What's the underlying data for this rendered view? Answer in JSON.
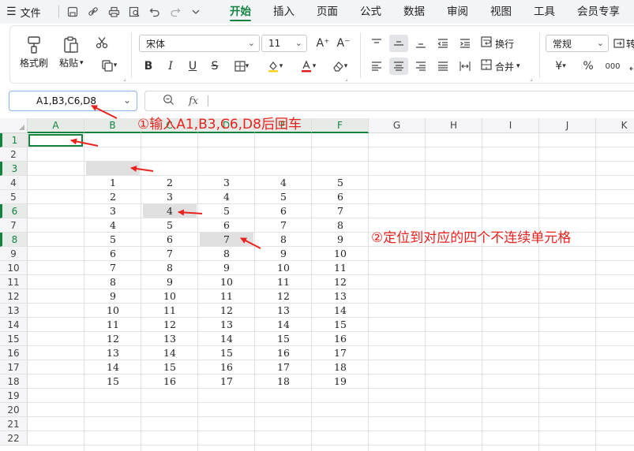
{
  "menubar": {
    "hamburger_icon": "☰",
    "file_label": "文件",
    "quick_icons": [
      "save-icon",
      "link-icon",
      "print-icon",
      "print-preview-icon",
      "undo-icon",
      "redo-icon",
      "more-chevron-icon"
    ],
    "tabs": [
      {
        "label": "开始",
        "active": true
      },
      {
        "label": "插入",
        "active": false
      },
      {
        "label": "页面",
        "active": false
      },
      {
        "label": "公式",
        "active": false
      },
      {
        "label": "数据",
        "active": false
      },
      {
        "label": "审阅",
        "active": false
      },
      {
        "label": "视图",
        "active": false
      },
      {
        "label": "工具",
        "active": false
      },
      {
        "label": "会员专享",
        "active": false
      }
    ]
  },
  "ribbon": {
    "format_painter_label": "格式刷",
    "paste_label": "粘贴",
    "font_name": "宋体",
    "font_size": "11",
    "wrap_label": "换行",
    "merge_label": "合并",
    "number_format": "常规",
    "bold": "B",
    "italic": "I",
    "underline": "U",
    "strike": "S",
    "increase_font": "A⁺",
    "decrease_font": "A⁻",
    "currency": "¥",
    "percent": "%",
    "thousands": "000",
    "last_label_partial": "转"
  },
  "formula_bar": {
    "name_box_value": "A1,B3,C6,D8",
    "fx_label": "fx"
  },
  "sheet": {
    "columns": [
      "A",
      "B",
      "C",
      "D",
      "E",
      "F",
      "G",
      "H",
      "I",
      "J",
      "K"
    ],
    "highlighted_columns": [
      "A",
      "B",
      "C",
      "D",
      "E",
      "F"
    ],
    "rows": [
      "1",
      "2",
      "3",
      "4",
      "5",
      "6",
      "7",
      "8",
      "9",
      "10",
      "11",
      "12",
      "13",
      "14",
      "15",
      "16",
      "17",
      "18",
      "19",
      "20",
      "21",
      "22"
    ],
    "highlighted_rows": [
      "1",
      "3",
      "6",
      "8"
    ],
    "data_start_row": 4,
    "data": [
      [
        1,
        2,
        3,
        4,
        5
      ],
      [
        2,
        3,
        4,
        5,
        6
      ],
      [
        3,
        4,
        5,
        6,
        7
      ],
      [
        4,
        5,
        6,
        7,
        8
      ],
      [
        5,
        6,
        7,
        8,
        9
      ],
      [
        6,
        7,
        8,
        9,
        10
      ],
      [
        7,
        8,
        9,
        10,
        11
      ],
      [
        8,
        9,
        10,
        11,
        12
      ],
      [
        9,
        10,
        11,
        12,
        13
      ],
      [
        10,
        11,
        12,
        13,
        14
      ],
      [
        11,
        12,
        13,
        14,
        15
      ],
      [
        12,
        13,
        14,
        15,
        16
      ],
      [
        13,
        14,
        15,
        16,
        17
      ],
      [
        14,
        15,
        16,
        17,
        18
      ],
      [
        15,
        16,
        17,
        18,
        19
      ]
    ],
    "selected_cells": [
      "A1",
      "B3",
      "C6",
      "D8"
    ]
  },
  "annotations": {
    "step1": "①输入A1,B3,C6,D8后回车",
    "step2": "②定位到对应的四个不连续单元格",
    "color": "#e8231f"
  }
}
